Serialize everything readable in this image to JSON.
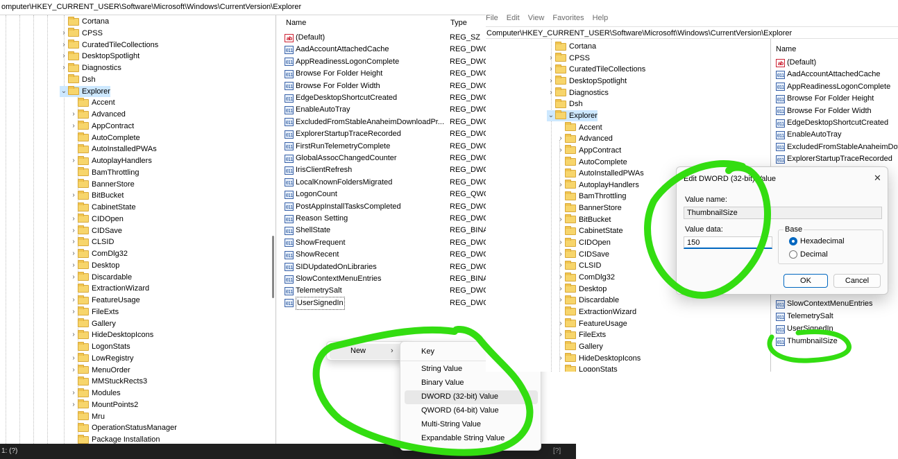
{
  "left_window": {
    "address": "omputer\\HKEY_CURRENT_USER\\Software\\Microsoft\\Windows\\CurrentVersion\\Explorer",
    "tree": [
      {
        "label": "Cortana",
        "chev": "",
        "depth": 0
      },
      {
        "label": "CPSS",
        "chev": ">",
        "depth": 0
      },
      {
        "label": "CuratedTileCollections",
        "chev": ">",
        "depth": 0
      },
      {
        "label": "DesktopSpotlight",
        "chev": ">",
        "depth": 0
      },
      {
        "label": "Diagnostics",
        "chev": ">",
        "depth": 0
      },
      {
        "label": "Dsh",
        "chev": "",
        "depth": 0
      },
      {
        "label": "Explorer",
        "chev": "v",
        "depth": 0,
        "selected": true
      },
      {
        "label": "Accent",
        "chev": "",
        "depth": 1
      },
      {
        "label": "Advanced",
        "chev": ">",
        "depth": 1
      },
      {
        "label": "AppContract",
        "chev": ">",
        "depth": 1
      },
      {
        "label": "AutoComplete",
        "chev": "",
        "depth": 1
      },
      {
        "label": "AutoInstalledPWAs",
        "chev": "",
        "depth": 1
      },
      {
        "label": "AutoplayHandlers",
        "chev": ">",
        "depth": 1
      },
      {
        "label": "BamThrottling",
        "chev": "",
        "depth": 1
      },
      {
        "label": "BannerStore",
        "chev": "",
        "depth": 1
      },
      {
        "label": "BitBucket",
        "chev": ">",
        "depth": 1
      },
      {
        "label": "CabinetState",
        "chev": "",
        "depth": 1
      },
      {
        "label": "CIDOpen",
        "chev": ">",
        "depth": 1
      },
      {
        "label": "CIDSave",
        "chev": ">",
        "depth": 1
      },
      {
        "label": "CLSID",
        "chev": ">",
        "depth": 1
      },
      {
        "label": "ComDlg32",
        "chev": ">",
        "depth": 1
      },
      {
        "label": "Desktop",
        "chev": ">",
        "depth": 1
      },
      {
        "label": "Discardable",
        "chev": ">",
        "depth": 1
      },
      {
        "label": "ExtractionWizard",
        "chev": "",
        "depth": 1
      },
      {
        "label": "FeatureUsage",
        "chev": ">",
        "depth": 1
      },
      {
        "label": "FileExts",
        "chev": ">",
        "depth": 1
      },
      {
        "label": "Gallery",
        "chev": "",
        "depth": 1
      },
      {
        "label": "HideDesktopIcons",
        "chev": ">",
        "depth": 1
      },
      {
        "label": "LogonStats",
        "chev": "",
        "depth": 1
      },
      {
        "label": "LowRegistry",
        "chev": ">",
        "depth": 1
      },
      {
        "label": "MenuOrder",
        "chev": ">",
        "depth": 1
      },
      {
        "label": "MMStuckRects3",
        "chev": "",
        "depth": 1
      },
      {
        "label": "Modules",
        "chev": ">",
        "depth": 1
      },
      {
        "label": "MountPoints2",
        "chev": ">",
        "depth": 1
      },
      {
        "label": "Mru",
        "chev": "",
        "depth": 1
      },
      {
        "label": "OperationStatusManager",
        "chev": "",
        "depth": 1
      },
      {
        "label": "Package Installation",
        "chev": "",
        "depth": 1
      }
    ],
    "columns": {
      "name": "Name",
      "type": "Type"
    },
    "values": [
      {
        "name": "(Default)",
        "type": "REG_SZ",
        "icon": "ab"
      },
      {
        "name": "AadAccountAttachedCache",
        "type": "REG_DWC",
        "icon": "bin"
      },
      {
        "name": "AppReadinessLogonComplete",
        "type": "REG_DWC",
        "icon": "bin"
      },
      {
        "name": "Browse For Folder Height",
        "type": "REG_DWC",
        "icon": "bin"
      },
      {
        "name": "Browse For Folder Width",
        "type": "REG_DWC",
        "icon": "bin"
      },
      {
        "name": "EdgeDesktopShortcutCreated",
        "type": "REG_DWC",
        "icon": "bin"
      },
      {
        "name": "EnableAutoTray",
        "type": "REG_DWC",
        "icon": "bin"
      },
      {
        "name": "ExcludedFromStableAnaheimDownloadPr...",
        "type": "REG_DWC",
        "icon": "bin"
      },
      {
        "name": "ExplorerStartupTraceRecorded",
        "type": "REG_DWC",
        "icon": "bin"
      },
      {
        "name": "FirstRunTelemetryComplete",
        "type": "REG_DWC",
        "icon": "bin"
      },
      {
        "name": "GlobalAssocChangedCounter",
        "type": "REG_DWC",
        "icon": "bin"
      },
      {
        "name": "IrisClientRefresh",
        "type": "REG_DWC",
        "icon": "bin"
      },
      {
        "name": "LocalKnownFoldersMigrated",
        "type": "REG_DWC",
        "icon": "bin"
      },
      {
        "name": "LogonCount",
        "type": "REG_QWC",
        "icon": "bin"
      },
      {
        "name": "PostAppInstallTasksCompleted",
        "type": "REG_DWC",
        "icon": "bin"
      },
      {
        "name": "Reason Setting",
        "type": "REG_DWC",
        "icon": "bin"
      },
      {
        "name": "ShellState",
        "type": "REG_BINA",
        "icon": "bin"
      },
      {
        "name": "ShowFrequent",
        "type": "REG_DWC",
        "icon": "bin"
      },
      {
        "name": "ShowRecent",
        "type": "REG_DWC",
        "icon": "bin"
      },
      {
        "name": "SIDUpdatedOnLibraries",
        "type": "REG_DWC",
        "icon": "bin"
      },
      {
        "name": "SlowContextMenuEntries",
        "type": "REG_BINA",
        "icon": "bin"
      },
      {
        "name": "TelemetrySalt",
        "type": "REG_DWC",
        "icon": "bin"
      },
      {
        "name": "UserSignedIn",
        "type": "REG_DWC",
        "icon": "bin"
      }
    ],
    "status": "1: (?)",
    "status_right": "[?]"
  },
  "context_menu": {
    "new_label": "New",
    "submenu": [
      "Key",
      "String Value",
      "Binary Value",
      "DWORD (32-bit) Value",
      "QWORD (64-bit) Value",
      "Multi-String Value",
      "Expandable String Value"
    ],
    "highlighted": "DWORD (32-bit) Value"
  },
  "right_window": {
    "menubar": [
      "File",
      "Edit",
      "View",
      "Favorites",
      "Help"
    ],
    "address": "Computer\\HKEY_CURRENT_USER\\Software\\Microsoft\\Windows\\CurrentVersion\\Explorer",
    "tree": [
      {
        "label": "Cortana",
        "chev": "",
        "depth": 0
      },
      {
        "label": "CPSS",
        "chev": ">",
        "depth": 0
      },
      {
        "label": "CuratedTileCollections",
        "chev": ">",
        "depth": 0
      },
      {
        "label": "DesktopSpotlight",
        "chev": ">",
        "depth": 0
      },
      {
        "label": "Diagnostics",
        "chev": ">",
        "depth": 0
      },
      {
        "label": "Dsh",
        "chev": "",
        "depth": 0
      },
      {
        "label": "Explorer",
        "chev": "v",
        "depth": 0,
        "selected": true
      },
      {
        "label": "Accent",
        "chev": "",
        "depth": 1
      },
      {
        "label": "Advanced",
        "chev": ">",
        "depth": 1
      },
      {
        "label": "AppContract",
        "chev": ">",
        "depth": 1
      },
      {
        "label": "AutoComplete",
        "chev": "",
        "depth": 1
      },
      {
        "label": "AutoInstalledPWAs",
        "chev": "",
        "depth": 1
      },
      {
        "label": "AutoplayHandlers",
        "chev": ">",
        "depth": 1
      },
      {
        "label": "BamThrottling",
        "chev": "",
        "depth": 1
      },
      {
        "label": "BannerStore",
        "chev": "",
        "depth": 1
      },
      {
        "label": "BitBucket",
        "chev": ">",
        "depth": 1
      },
      {
        "label": "CabinetState",
        "chev": "",
        "depth": 1
      },
      {
        "label": "CIDOpen",
        "chev": ">",
        "depth": 1
      },
      {
        "label": "CIDSave",
        "chev": ">",
        "depth": 1
      },
      {
        "label": "CLSID",
        "chev": ">",
        "depth": 1
      },
      {
        "label": "ComDlg32",
        "chev": ">",
        "depth": 1
      },
      {
        "label": "Desktop",
        "chev": ">",
        "depth": 1
      },
      {
        "label": "Discardable",
        "chev": ">",
        "depth": 1
      },
      {
        "label": "ExtractionWizard",
        "chev": "",
        "depth": 1
      },
      {
        "label": "FeatureUsage",
        "chev": ">",
        "depth": 1
      },
      {
        "label": "FileExts",
        "chev": ">",
        "depth": 1
      },
      {
        "label": "Gallery",
        "chev": "",
        "depth": 1
      },
      {
        "label": "HideDesktopIcons",
        "chev": ">",
        "depth": 1
      },
      {
        "label": "LogonStats",
        "chev": "",
        "depth": 1
      }
    ],
    "column_name": "Name",
    "values": [
      {
        "name": "(Default)",
        "icon": "ab"
      },
      {
        "name": "AadAccountAttachedCache",
        "icon": "bin"
      },
      {
        "name": "AppReadinessLogonComplete",
        "icon": "bin"
      },
      {
        "name": "Browse For Folder Height",
        "icon": "bin"
      },
      {
        "name": "Browse For Folder Width",
        "icon": "bin"
      },
      {
        "name": "EdgeDesktopShortcutCreated",
        "icon": "bin"
      },
      {
        "name": "EnableAutoTray",
        "icon": "bin"
      },
      {
        "name": "ExcludedFromStableAnaheimDow",
        "icon": "bin"
      },
      {
        "name": "ExplorerStartupTraceRecorded",
        "icon": "bin"
      }
    ],
    "values_lower": [
      {
        "name": "SlowContextMenuEntries",
        "icon": "bin"
      },
      {
        "name": "TelemetrySalt",
        "icon": "bin"
      },
      {
        "name": "UserSignedIn",
        "icon": "bin"
      },
      {
        "name": "ThumbnailSize",
        "icon": "bin"
      }
    ]
  },
  "dialog": {
    "title": "Edit DWORD (32-bit) Value",
    "value_name_label": "Value name:",
    "value_name": "ThumbnailSize",
    "value_data_label": "Value data:",
    "value_data": "150",
    "base_label": "Base",
    "radio_hex": "Hexadecimal",
    "radio_dec": "Decimal",
    "ok": "OK",
    "cancel": "Cancel",
    "close_glyph": "✕"
  },
  "colors": {
    "annotation": "#33dd11",
    "selection": "#cde8ff",
    "folder": "#f7d56b",
    "accent": "#0067c0"
  }
}
